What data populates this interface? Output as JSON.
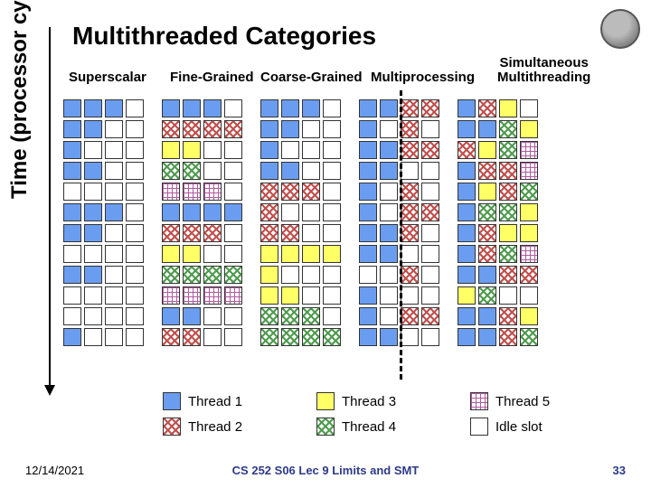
{
  "title": "Multithreaded Categories",
  "yaxis_label": "Time (processor cycle)",
  "columns": [
    {
      "label": "Superscalar"
    },
    {
      "label": "Fine-Grained"
    },
    {
      "label": "Coarse-Grained"
    },
    {
      "label": "Multiprocessing"
    },
    {
      "label": "Simultaneous\nMultithreading"
    }
  ],
  "legend": [
    {
      "name": "Thread 1",
      "style": "t1"
    },
    {
      "name": "Thread 3",
      "style": "t3"
    },
    {
      "name": "Thread 5",
      "style": "t5"
    },
    {
      "name": "Thread 2",
      "style": "t2"
    },
    {
      "name": "Thread 4",
      "style": "t4"
    },
    {
      "name": "Idle slot",
      "style": "t0"
    }
  ],
  "footer": {
    "date": "12/14/2021",
    "center": "CS 252 S06 Lec 9 Limits and SMT",
    "page": "33"
  },
  "chart_data": {
    "type": "table",
    "rows": 12,
    "cols_per_group": 4,
    "cell_legend": {
      "0": "Idle",
      "1": "Thread 1",
      "2": "Thread 2",
      "3": "Thread 3",
      "4": "Thread 4",
      "5": "Thread 5"
    },
    "groups": [
      {
        "name": "Superscalar",
        "grid": [
          [
            1,
            1,
            1,
            0
          ],
          [
            1,
            1,
            0,
            0
          ],
          [
            1,
            0,
            0,
            0
          ],
          [
            1,
            1,
            0,
            0
          ],
          [
            0,
            0,
            0,
            0
          ],
          [
            1,
            1,
            1,
            0
          ],
          [
            1,
            1,
            0,
            0
          ],
          [
            0,
            0,
            0,
            0
          ],
          [
            1,
            1,
            0,
            0
          ],
          [
            0,
            0,
            0,
            0
          ],
          [
            0,
            0,
            0,
            0
          ],
          [
            1,
            0,
            0,
            0
          ]
        ]
      },
      {
        "name": "Fine-Grained",
        "grid": [
          [
            1,
            1,
            1,
            0
          ],
          [
            2,
            2,
            2,
            2
          ],
          [
            3,
            3,
            0,
            0
          ],
          [
            4,
            4,
            0,
            0
          ],
          [
            5,
            5,
            5,
            0
          ],
          [
            1,
            1,
            1,
            1
          ],
          [
            2,
            2,
            2,
            0
          ],
          [
            3,
            3,
            0,
            0
          ],
          [
            4,
            4,
            4,
            4
          ],
          [
            5,
            5,
            5,
            5
          ],
          [
            1,
            1,
            0,
            0
          ],
          [
            2,
            2,
            0,
            0
          ]
        ]
      },
      {
        "name": "Coarse-Grained",
        "grid": [
          [
            1,
            1,
            1,
            0
          ],
          [
            1,
            1,
            0,
            0
          ],
          [
            1,
            0,
            0,
            0
          ],
          [
            1,
            1,
            0,
            0
          ],
          [
            2,
            2,
            2,
            0
          ],
          [
            2,
            0,
            0,
            0
          ],
          [
            2,
            2,
            0,
            0
          ],
          [
            3,
            3,
            3,
            3
          ],
          [
            3,
            0,
            0,
            0
          ],
          [
            3,
            3,
            0,
            0
          ],
          [
            4,
            4,
            4,
            0
          ],
          [
            4,
            4,
            4,
            4
          ]
        ]
      },
      {
        "name": "Multiprocessing",
        "grid": [
          [
            1,
            1,
            2,
            2
          ],
          [
            1,
            0,
            2,
            0
          ],
          [
            1,
            1,
            2,
            2
          ],
          [
            1,
            1,
            0,
            0
          ],
          [
            1,
            0,
            2,
            0
          ],
          [
            1,
            0,
            2,
            2
          ],
          [
            1,
            1,
            2,
            0
          ],
          [
            1,
            1,
            0,
            0
          ],
          [
            0,
            0,
            2,
            0
          ],
          [
            1,
            0,
            0,
            0
          ],
          [
            1,
            0,
            2,
            2
          ],
          [
            1,
            1,
            0,
            0
          ]
        ]
      },
      {
        "name": "Simultaneous Multithreading",
        "grid": [
          [
            1,
            2,
            3,
            0
          ],
          [
            1,
            1,
            4,
            3
          ],
          [
            2,
            3,
            4,
            5
          ],
          [
            1,
            2,
            2,
            5
          ],
          [
            1,
            3,
            2,
            4
          ],
          [
            1,
            4,
            4,
            3
          ],
          [
            1,
            2,
            3,
            3
          ],
          [
            1,
            2,
            4,
            5
          ],
          [
            1,
            1,
            2,
            2
          ],
          [
            3,
            4,
            0,
            0
          ],
          [
            1,
            1,
            2,
            3
          ],
          [
            1,
            1,
            2,
            4
          ]
        ]
      }
    ]
  }
}
